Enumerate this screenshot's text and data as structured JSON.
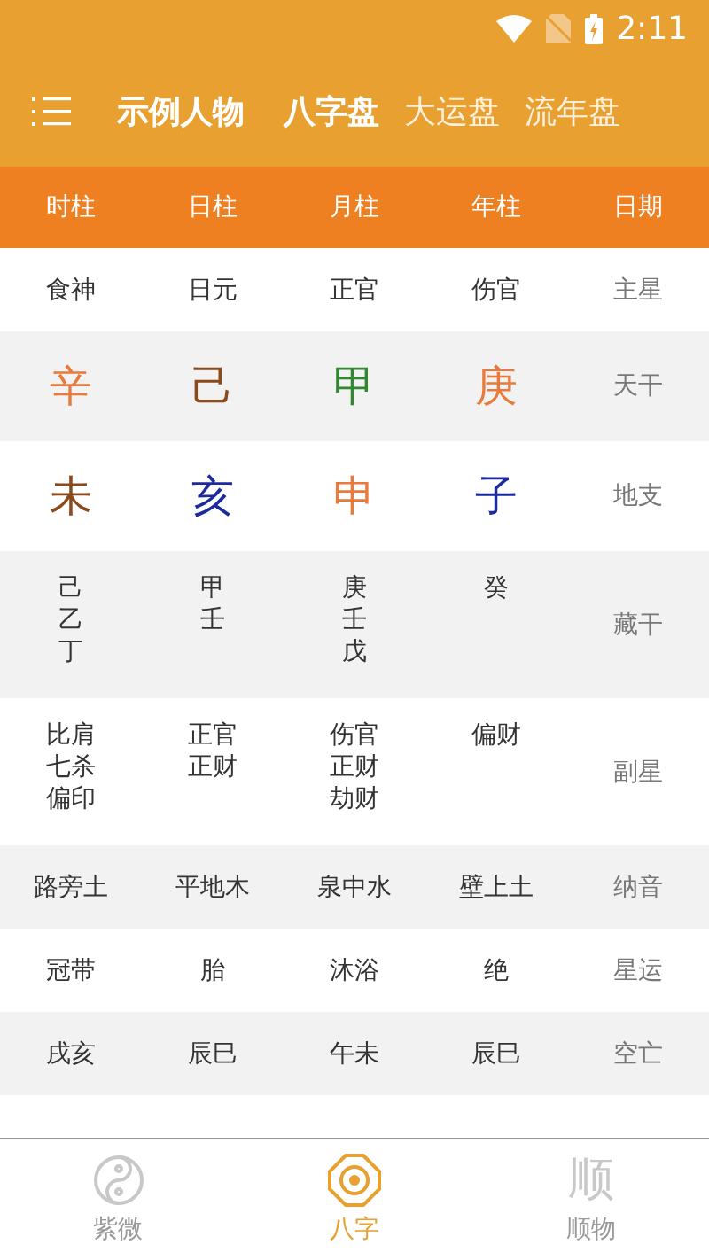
{
  "status_bar": {
    "time": "2:11"
  },
  "header": {
    "title": "示例人物",
    "tabs": [
      {
        "label": "八字盘",
        "selected": true
      },
      {
        "label": "大运盘",
        "selected": false
      },
      {
        "label": "流年盘",
        "selected": false
      }
    ]
  },
  "table": {
    "columns": [
      "时柱",
      "日柱",
      "月柱",
      "年柱",
      "日期"
    ],
    "rows": [
      {
        "kind": "text",
        "label": "主星",
        "cells": [
          [
            "食神"
          ],
          [
            "日元"
          ],
          [
            "正官"
          ],
          [
            "伤官"
          ]
        ]
      },
      {
        "kind": "glyph",
        "label": "天干",
        "cells": [
          {
            "text": "辛",
            "color": "#e87b3c"
          },
          {
            "text": "己",
            "color": "#8b4a1c"
          },
          {
            "text": "甲",
            "color": "#2f8a2f"
          },
          {
            "text": "庚",
            "color": "#e87b3c"
          }
        ]
      },
      {
        "kind": "glyph",
        "label": "地支",
        "cells": [
          {
            "text": "未",
            "color": "#8b4a1c"
          },
          {
            "text": "亥",
            "color": "#1c2a9c"
          },
          {
            "text": "申",
            "color": "#e87b3c"
          },
          {
            "text": "子",
            "color": "#1c2a9c"
          }
        ]
      },
      {
        "kind": "text",
        "label": "藏干",
        "cells": [
          [
            "己",
            "乙",
            "丁"
          ],
          [
            "甲",
            "壬"
          ],
          [
            "庚",
            "壬",
            "戊"
          ],
          [
            "癸"
          ]
        ]
      },
      {
        "kind": "text",
        "label": "副星",
        "cells": [
          [
            "比肩",
            "七杀",
            "偏印"
          ],
          [
            "正官",
            "正财"
          ],
          [
            "伤官",
            "正财",
            "劫财"
          ],
          [
            "偏财"
          ]
        ]
      },
      {
        "kind": "text",
        "label": "纳音",
        "cells": [
          [
            "路旁土"
          ],
          [
            "平地木"
          ],
          [
            "泉中水"
          ],
          [
            "壁上土"
          ]
        ]
      },
      {
        "kind": "text",
        "label": "星运",
        "cells": [
          [
            "冠带"
          ],
          [
            "胎"
          ],
          [
            "沐浴"
          ],
          [
            "绝"
          ]
        ]
      },
      {
        "kind": "text",
        "label": "空亡",
        "cells": [
          [
            "戌亥"
          ],
          [
            "辰巳"
          ],
          [
            "午未"
          ],
          [
            "辰巳"
          ]
        ]
      }
    ]
  },
  "bottom_nav": [
    {
      "label": "紫微",
      "kind": "yinyang",
      "selected": false
    },
    {
      "label": "八字",
      "kind": "bagua",
      "selected": true
    },
    {
      "label": "顺物",
      "kind": "glyph",
      "glyph": "顺",
      "selected": false
    }
  ]
}
